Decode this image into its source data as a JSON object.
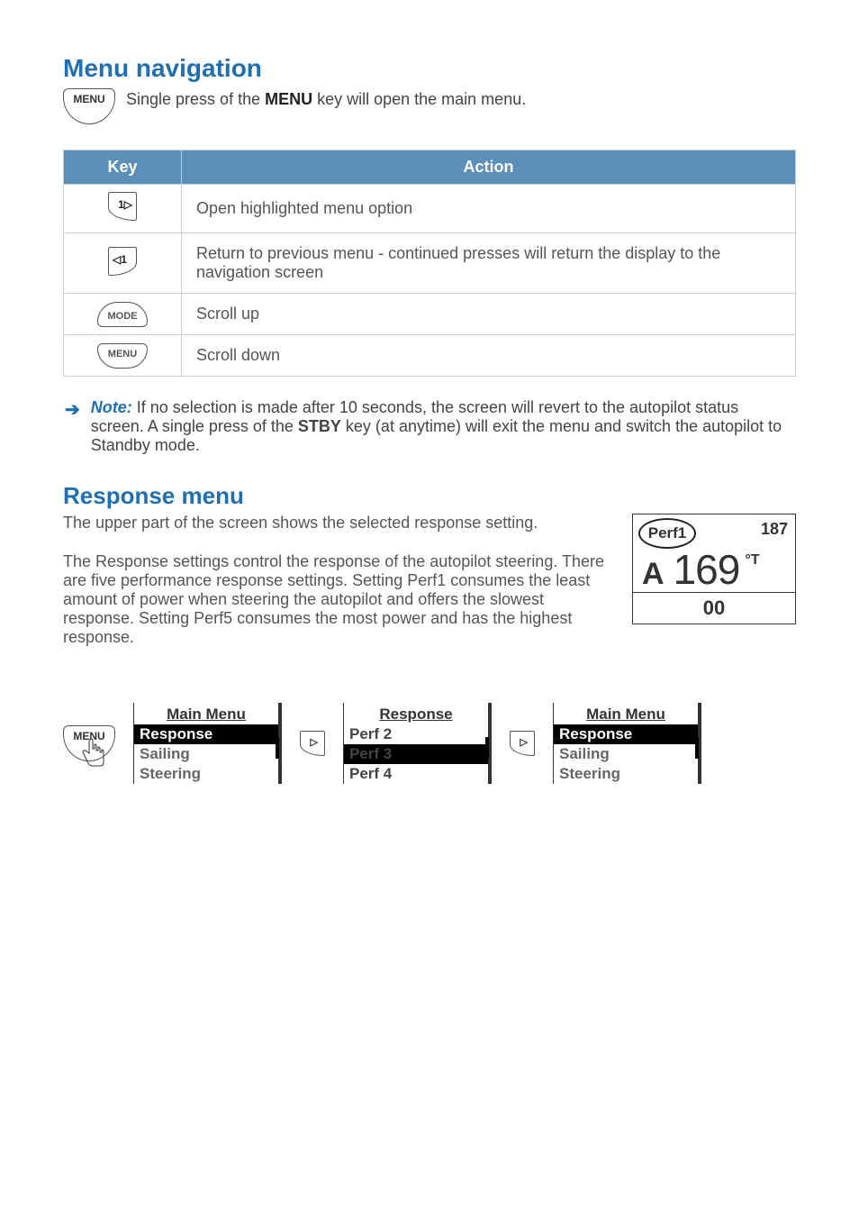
{
  "section1": {
    "heading": "Menu navigation",
    "intro_pre": "Single press of the ",
    "intro_key": "MENU",
    "intro_post": " key will open the main menu.",
    "menu_key_label": "MENU"
  },
  "table": {
    "head_key": "Key",
    "head_action": "Action",
    "rows": [
      {
        "icon": "right",
        "action": "Open highlighted menu option"
      },
      {
        "icon": "left",
        "action": "Return to previous menu - continued presses will return the display to the navigation screen"
      },
      {
        "icon": "mode",
        "label": "MODE",
        "action": "Scroll up"
      },
      {
        "icon": "menu",
        "label": "MENU",
        "action": "Scroll down"
      }
    ]
  },
  "note": {
    "label": "Note:",
    "text_a": " If no selection is made after 10 seconds, the screen will revert to the autopilot status screen. A single press of the ",
    "stby": "STBY",
    "text_b": " key (at anytime) will exit the menu and switch the autopilot to Standby mode."
  },
  "section2": {
    "heading": "Response menu",
    "p1": "The upper part of the screen shows the selected response setting.",
    "p2": "The Response settings control the response of the autopilot steering. There are five performance response settings. Setting Perf1 consumes the least amount of power when steering the autopilot and offers the slowest response. Setting Perf5 consumes the most power and has the highest response."
  },
  "pilot": {
    "perf": "Perf1",
    "topnum": "187",
    "mode_letter": "A",
    "heading": "169",
    "unit": "°T",
    "bottom": "00"
  },
  "flow": {
    "menu_label": "MENU",
    "screen1": {
      "title": "Main Menu",
      "items": [
        "Response",
        "Sailing",
        "Steering"
      ],
      "selected": 0
    },
    "screen2": {
      "title": "Response",
      "items": [
        "Perf 2",
        "Perf 3",
        "Perf 4"
      ],
      "selected": 1
    },
    "screen3": {
      "title": "Main Menu",
      "items": [
        "Response",
        "Sailing",
        "Steering"
      ],
      "selected": 0
    }
  }
}
